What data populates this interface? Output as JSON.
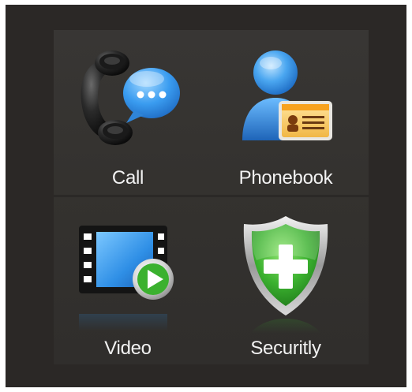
{
  "menu": {
    "items": [
      {
        "label": "Call",
        "icon": "phone-chat-icon"
      },
      {
        "label": "Phonebook",
        "icon": "contact-card-icon"
      },
      {
        "label": "Video",
        "icon": "video-play-icon"
      },
      {
        "label": "Securitly",
        "icon": "shield-plus-icon"
      }
    ]
  },
  "colors": {
    "background": "#2b2826",
    "panel": "#363432",
    "label": "#f2f2f2",
    "accent_blue": "#2f8fe6",
    "accent_green": "#3bb12f"
  }
}
